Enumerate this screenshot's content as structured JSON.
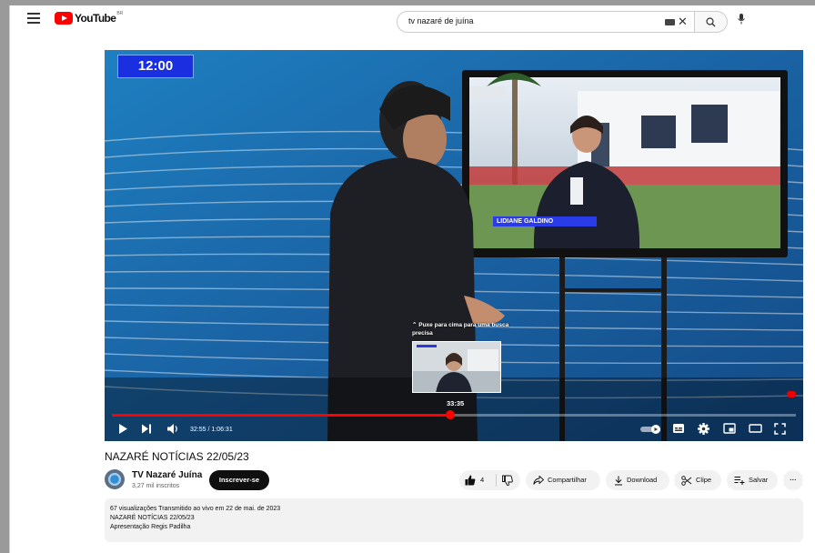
{
  "header": {
    "logo_text": "YouTube",
    "logo_region": "BR",
    "search_value": "tv nazaré de juína"
  },
  "player": {
    "clock": "12:00",
    "lower_third_name": "LIDIANE GALDINO",
    "preview_hint": "⌃ Puxe para cima para uma busca precisa",
    "preview_time": "33:35",
    "current_time": "32:55",
    "duration": "1:06:31",
    "time_display": "32:55 / 1:06:31",
    "progress_fraction": 0.495,
    "accent_color": "#ff0000"
  },
  "video": {
    "title": "NAZARÉ NOTÍCIAS 22/05/23"
  },
  "channel": {
    "name": "TV Nazaré Juína",
    "subscribers": "3,27 mil inscritos",
    "subscribe_label": "Inscrever-se"
  },
  "actions": {
    "likes": "4",
    "share": "Compartilhar",
    "download": "Download",
    "clip": "Clipe",
    "save": "Salvar",
    "more": "···"
  },
  "description": {
    "meta": "67 visualizações  Transmitido ao vivo em 22 de mai. de 2023",
    "line1": "NAZARÉ NOTÍCIAS 22/05/23",
    "line2": "Apresentação Regis Padilha"
  }
}
